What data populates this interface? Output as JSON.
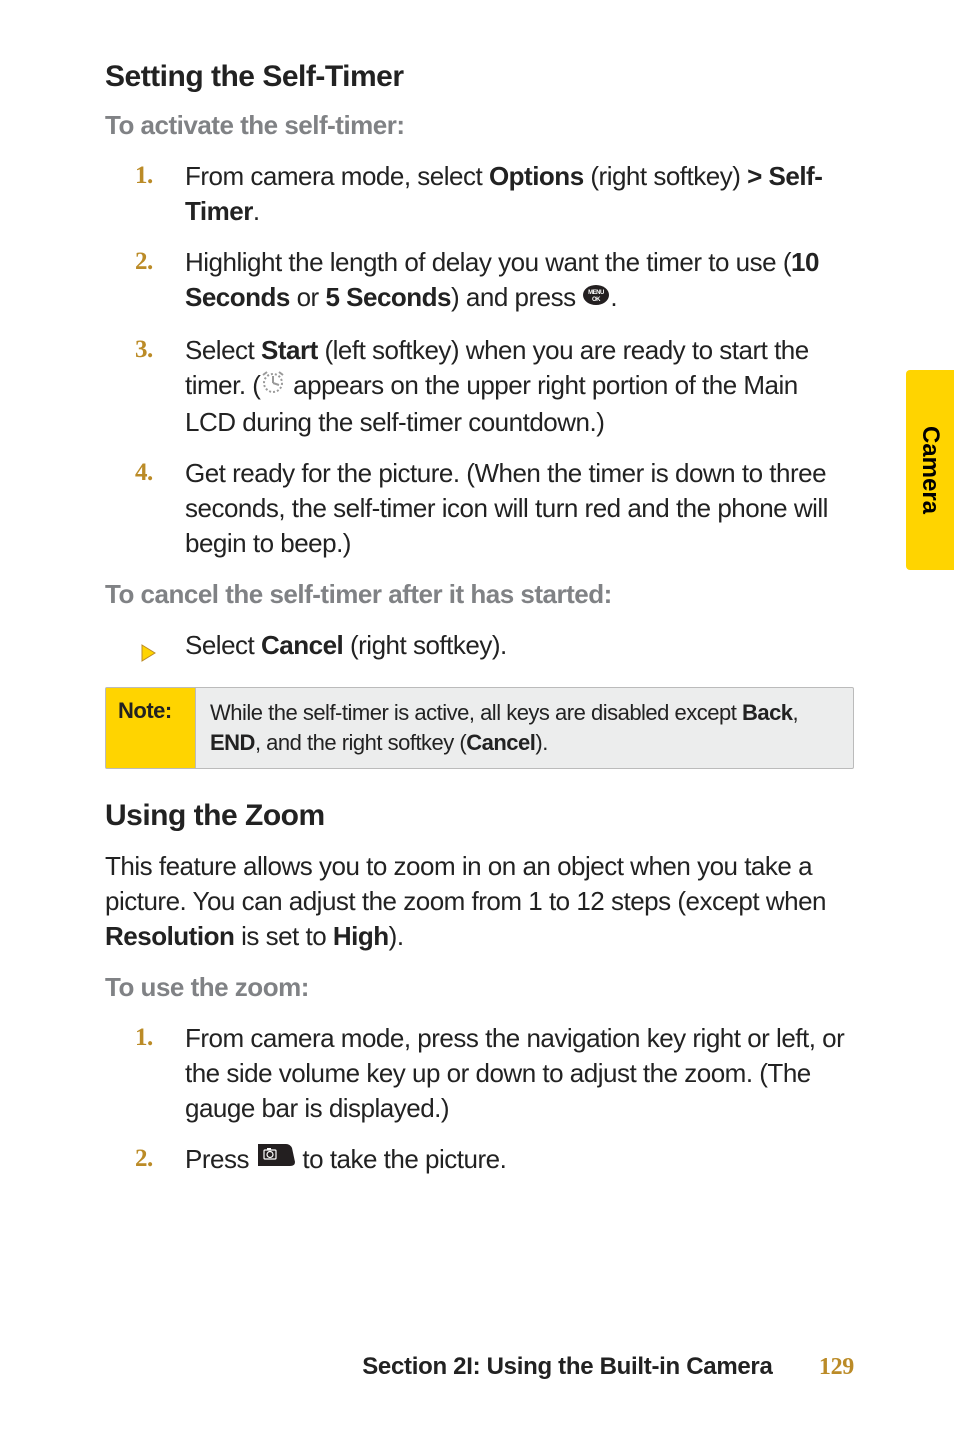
{
  "sideTab": "Camera",
  "section1": {
    "heading": "Setting the Self-Timer",
    "sub1": "To activate the self-timer:",
    "steps": [
      {
        "num": "1.",
        "pre": "From camera mode, select ",
        "b1": "Options",
        "mid1": " (right softkey) ",
        "b2": ">",
        "mid2": " ",
        "b3": "Self-Timer",
        "post": "."
      },
      {
        "num": "2.",
        "pre": "Highlight the length of delay you want the timer to use (",
        "b1": "10 Seconds",
        "mid1": " or ",
        "b2": "5 Seconds",
        "post": ") and press "
      },
      {
        "num": "3.",
        "pre": "Select ",
        "b1": "Start",
        "post": " (left softkey) when you are ready to start the timer. (",
        "post2": " appears on the upper right portion of the Main LCD during the self-timer countdown.)"
      },
      {
        "num": "4.",
        "text": "Get ready for the picture. (When the timer is down to three seconds, the self-timer icon will turn red and the phone will begin to beep.)"
      }
    ],
    "sub2": "To cancel the self-timer after it has started:",
    "cancelPre": "Select ",
    "cancelBold": "Cancel",
    "cancelPost": " (right softkey)."
  },
  "note": {
    "label": "Note:",
    "pre": "While the self-timer is active, all keys are disabled except ",
    "b1": "Back",
    "c1": ", ",
    "b2": "END",
    "c2": ", and the right softkey (",
    "b3": "Cancel",
    "post": ")."
  },
  "section2": {
    "heading": "Using the Zoom",
    "paraPre": "This feature allows you to zoom in on an object when you take a picture. You can adjust the zoom from 1 to 12 steps (except when ",
    "paraB1": "Resolution",
    "paraMid": " is set to ",
    "paraB2": "High",
    "paraPost": ").",
    "sub": "To use the zoom:",
    "steps": [
      {
        "num": "1.",
        "text": "From camera mode, press the navigation key right or left, or the side volume key up or down to adjust the zoom. (The gauge bar is displayed.)"
      },
      {
        "num": "2.",
        "pre": "Press ",
        "post": " to take the picture."
      }
    ]
  },
  "footer": {
    "section": "Section 2I: Using the Built-in Camera",
    "page": "129"
  }
}
